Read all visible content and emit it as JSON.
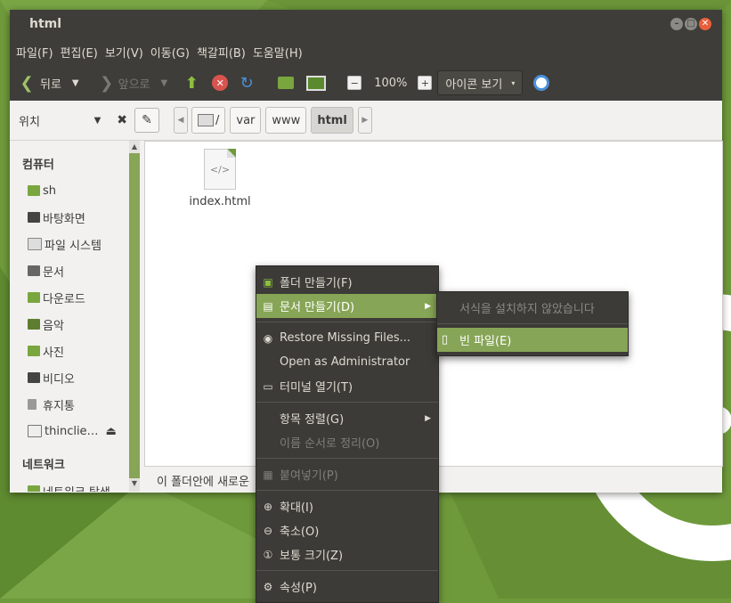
{
  "window": {
    "title": "html"
  },
  "menubar": [
    "파일(F)",
    "편집(E)",
    "보기(V)",
    "이동(G)",
    "책갈피(B)",
    "도움말(H)"
  ],
  "toolbar": {
    "back": "뒤로",
    "forward": "앞으로",
    "zoom": "100%",
    "view_mode": "아이콘 보기"
  },
  "location": {
    "places_label": "위치",
    "crumbs": [
      "/",
      "var",
      "www",
      "html"
    ]
  },
  "sidebar": {
    "computer_heading": "컴퓨터",
    "items": [
      "sh",
      "바탕화면",
      "파일 시스템",
      "문서",
      "다운로드",
      "음악",
      "사진",
      "비디오",
      "휴지통",
      "thinclie…"
    ],
    "network_heading": "네트워크",
    "network_items": [
      "네트워크 탐색"
    ]
  },
  "files": [
    {
      "name": "index.html"
    }
  ],
  "status": "이 폴더안에 새로운",
  "context_menu": {
    "create_folder": "폴더 만들기(F)",
    "create_document": "문서 만들기(D)",
    "restore": "Restore Missing Files...",
    "open_admin": "Open as Administrator",
    "terminal": "터미널 열기(T)",
    "arrange": "항목 정렬(G)",
    "sort_by_name": "이름 순서로 정리(O)",
    "paste": "붙여넣기(P)",
    "zoom_in": "확대(I)",
    "zoom_out": "축소(O)",
    "normal_size": "보통 크기(Z)",
    "properties": "속성(P)"
  },
  "submenu": {
    "no_templates": "서식을 설치하지 않았습니다",
    "empty_file": "빈 파일(E)"
  }
}
